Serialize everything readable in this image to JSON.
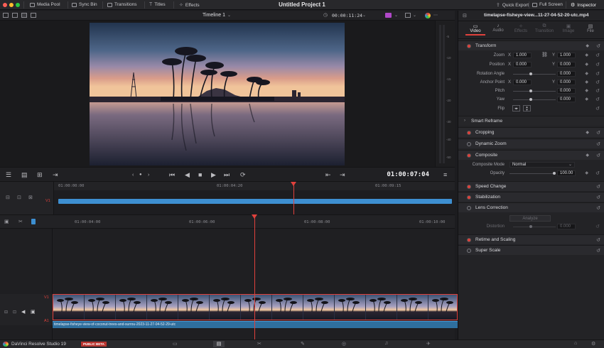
{
  "topbar": {
    "items": [
      "Media Pool",
      "Sync Bin",
      "Transitions",
      "Titles",
      "Effects"
    ],
    "project_title": "Untitled Project 1",
    "quick_export": "Quick Export",
    "full_screen": "Full Screen",
    "inspector": "Inspector",
    "window_colors": [
      "#ff5f57",
      "#febc2e",
      "#28c840"
    ]
  },
  "viewer": {
    "timeline_name": "Timeline 1",
    "duration": "00:00:11:24",
    "meter_scale": [
      "-5",
      "-10",
      "-15",
      "-20",
      "-30",
      "-40",
      "-50"
    ]
  },
  "transport": {
    "timecode": "01:00:07:04"
  },
  "upper_timeline": {
    "ticks": [
      "01:00:00:00",
      "01:00:04:20",
      "01:00:09:15"
    ],
    "track_label": "V1"
  },
  "lower_timeline": {
    "ticks": [
      "01:00:04:00",
      "01:00:06:00",
      "01:00:08:00",
      "01:00:10:00"
    ],
    "video_track": "V1",
    "audio_track": "A1",
    "audio_clip_name": "timelapse-fisheye-view-of-coconut-trees-and-surrou-2023-11-27-04-52-29-utc"
  },
  "inspector": {
    "clip_name": "timelapse-fisheye-view...11-27-04-52-20-utc.mp4",
    "tabs": [
      "Video",
      "Audio",
      "Effects",
      "Transition",
      "Image",
      "File"
    ],
    "active_tab": "Video",
    "transform": {
      "title": "Transform",
      "zoom_label": "Zoom",
      "zoom_x": "1.000",
      "zoom_y": "1.000",
      "position_label": "Position",
      "position_x": "0.000",
      "position_y": "0.000",
      "rotation_label": "Rotation Angle",
      "rotation": "0.000",
      "anchor_label": "Anchor Point",
      "anchor_x": "0.000",
      "anchor_y": "0.000",
      "pitch_label": "Pitch",
      "pitch": "0.000",
      "yaw_label": "Yaw",
      "yaw": "0.000",
      "flip_label": "Flip",
      "x_axis": "X",
      "y_axis": "Y"
    },
    "smart_reframe": "Smart Reframe",
    "cropping": "Cropping",
    "dynamic_zoom": "Dynamic Zoom",
    "composite": {
      "title": "Composite",
      "mode_label": "Composite Mode",
      "mode_value": "Normal",
      "opacity_label": "Opacity",
      "opacity_value": "100.00"
    },
    "speed_change": "Speed Change",
    "stabilization": "Stabilization",
    "lens_correction": {
      "title": "Lens Correction",
      "analyze": "Analyze",
      "distortion_label": "Distortion",
      "distortion_value": "0.000"
    },
    "retime_scaling": "Retime and Scaling",
    "super_scale": "Super Scale"
  },
  "bottombar": {
    "app_name": "DaVinci Resolve Studio 19",
    "badge": "PUBLIC BETA"
  },
  "colors": {
    "accent_red": "#e0413c",
    "clip_blue": "#3d8fd1",
    "active_tab": "#e0413c"
  }
}
